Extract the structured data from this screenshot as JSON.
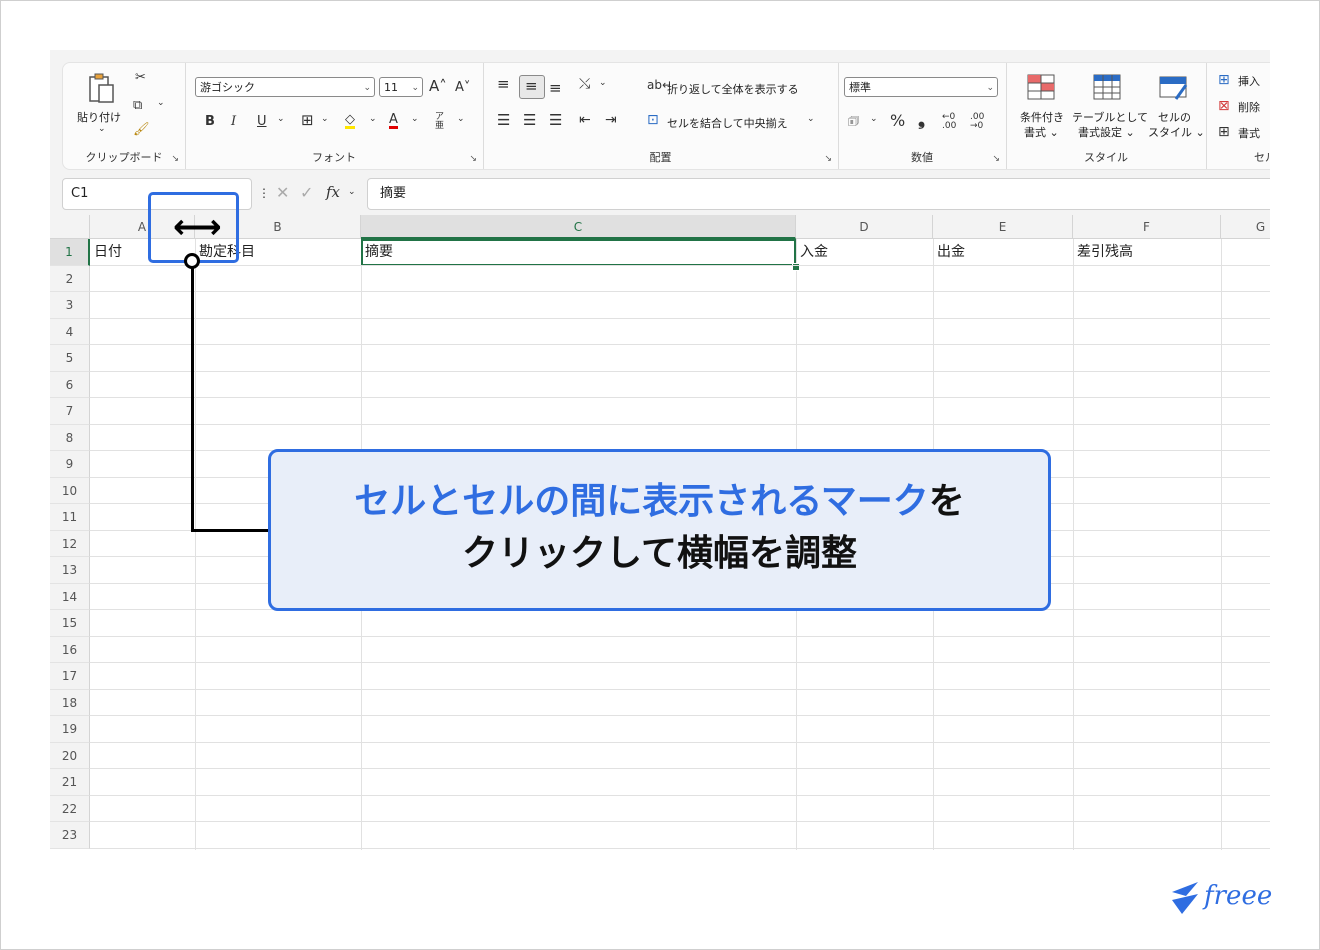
{
  "ribbon": {
    "clipboard": {
      "paste_label": "貼り付け",
      "group_label": "クリップボード"
    },
    "font": {
      "font_name": "游ゴシック",
      "font_size": "11",
      "group_label": "フォント",
      "bold": "B",
      "italic": "I",
      "underline": "U"
    },
    "alignment": {
      "wrap_text": "折り返して全体を表示する",
      "merge_center": "セルを結合して中央揃え",
      "group_label": "配置"
    },
    "number": {
      "format": "標準",
      "percent": "%",
      "comma": "❟",
      "group_label": "数値"
    },
    "styles": {
      "conditional_line1": "条件付き",
      "conditional_line2": "書式 ⌄",
      "table_line1": "テーブルとして",
      "table_line2": "書式設定 ⌄",
      "cell_line1": "セルの",
      "cell_line2": "スタイル ⌄",
      "group_label": "スタイル"
    },
    "cells": {
      "insert": "挿入",
      "delete": "削除",
      "format": "書式",
      "group_label": "セル"
    }
  },
  "formula_bar": {
    "name_box": "C1",
    "fx": "fx",
    "content": "摘要"
  },
  "sheet": {
    "columns": [
      "A",
      "B",
      "C",
      "D",
      "E",
      "F",
      "G"
    ],
    "rows": [
      "1",
      "2",
      "3",
      "4",
      "5",
      "6",
      "7",
      "8",
      "9",
      "10",
      "11",
      "12",
      "13",
      "14",
      "15",
      "16",
      "17",
      "18",
      "19",
      "20",
      "21",
      "22",
      "23"
    ],
    "row1": {
      "a": "日付",
      "b": "勘定科目",
      "c": "摘要",
      "d": "入金",
      "e": "出金",
      "f": "差引残高"
    },
    "active_cell": "C1"
  },
  "callout": {
    "line1_blue": "セルとセルの間に表示されるマーク",
    "line1_black": "を",
    "line2": "クリックして横幅を調整"
  },
  "brand": {
    "logo_text": "freee",
    "accent_color": "#2f6de1",
    "excel_green": "#217346"
  }
}
